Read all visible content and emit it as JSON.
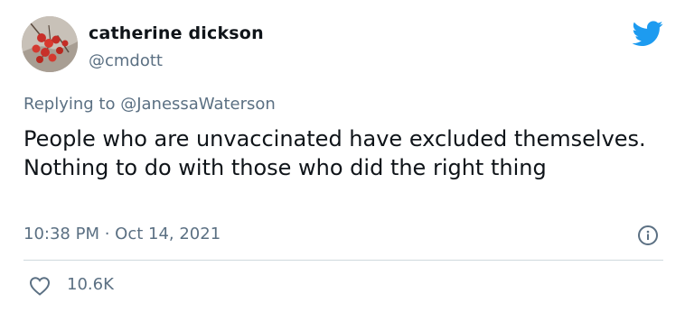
{
  "author": {
    "name": "catherine dickson",
    "handle": "@cmdott",
    "avatar_icon": "berries-photo"
  },
  "brand": {
    "icon": "twitter-bird-icon",
    "color": "#1d9bf0"
  },
  "reply": {
    "prefix": "Replying to ",
    "mention": "@JanessaWaterson"
  },
  "tweet": {
    "text": "People who are unvaccinated have excluded themselves.  Nothing to do with those who did the right thing"
  },
  "meta": {
    "time": "10:38 PM",
    "separator": " · ",
    "date": "Oct 14, 2021",
    "info_icon": "info-icon"
  },
  "actions": {
    "like_icon": "heart-icon",
    "like_count": "10.6K"
  }
}
